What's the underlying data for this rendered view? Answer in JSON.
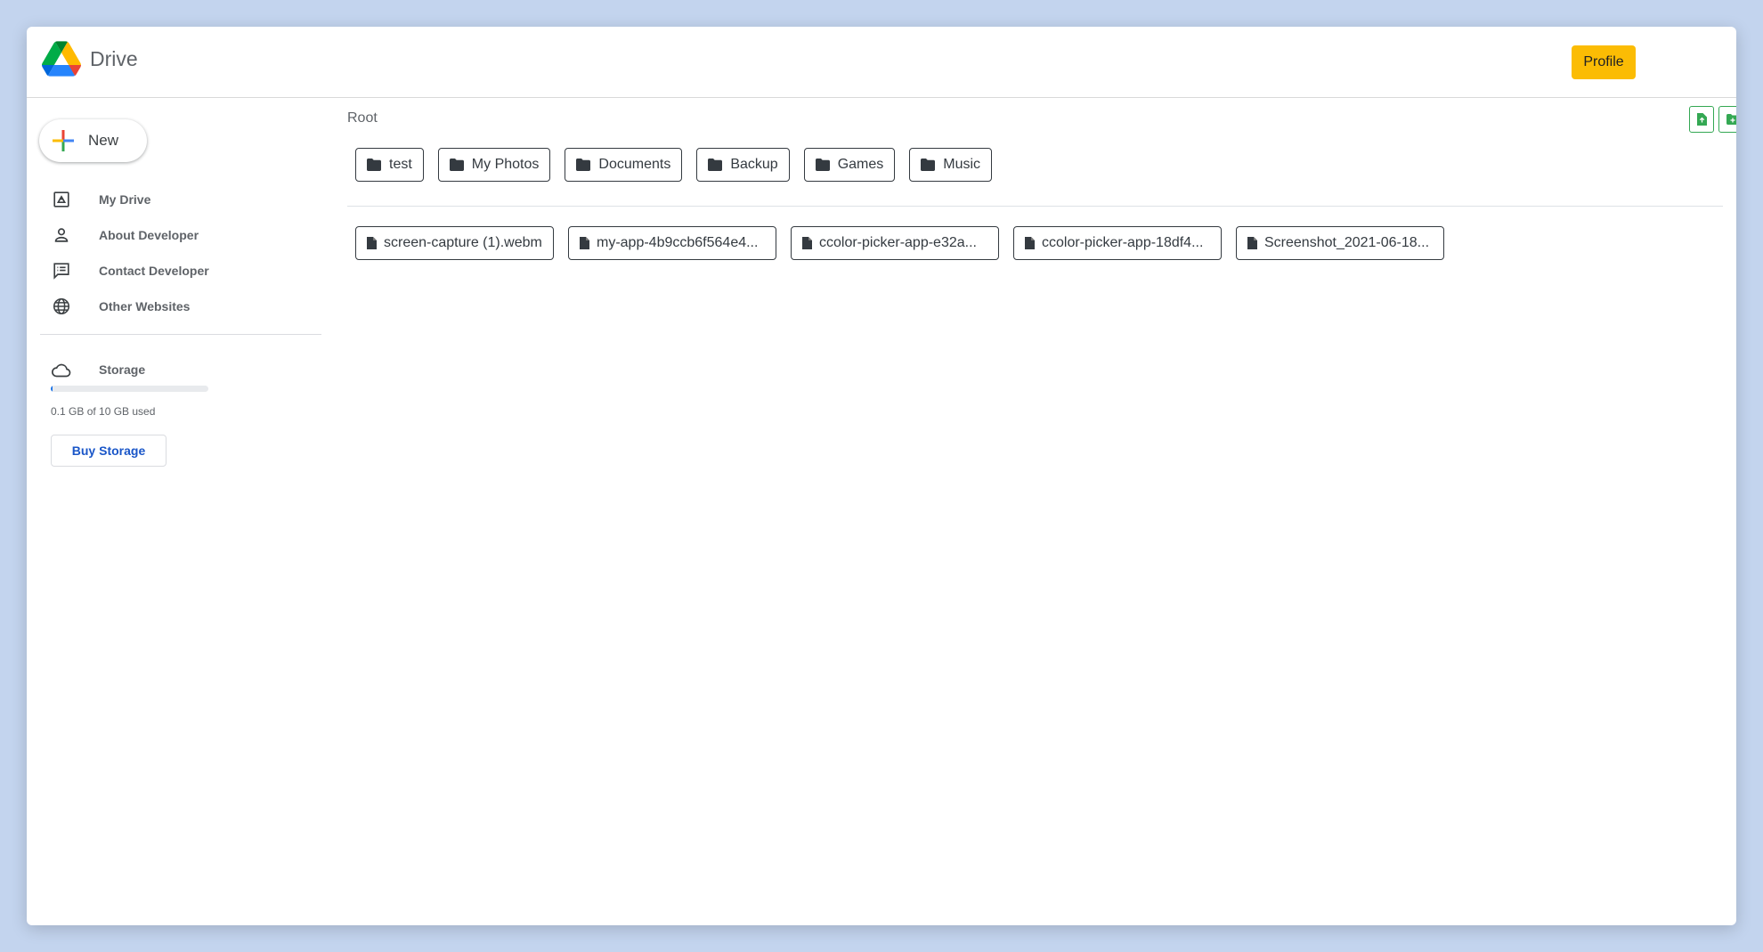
{
  "header": {
    "app_name": "Drive",
    "profile_label": "Profile"
  },
  "sidebar": {
    "new_label": "New",
    "items": [
      {
        "label": "My Drive",
        "icon": "drive-icon"
      },
      {
        "label": "About Developer",
        "icon": "person-icon"
      },
      {
        "label": "Contact Developer",
        "icon": "feedback-icon"
      },
      {
        "label": "Other Websites",
        "icon": "globe-icon"
      }
    ],
    "storage": {
      "label": "Storage",
      "icon": "cloud-icon",
      "usage_text": "0.1 GB of 10 GB used",
      "used_fraction": 0.01,
      "buy_label": "Buy Storage"
    }
  },
  "main": {
    "breadcrumb": "Root",
    "folders": [
      "test",
      "My Photos",
      "Documents",
      "Backup",
      "Games",
      "Music"
    ],
    "files": [
      "screen-capture (1).webm",
      "my-app-4b9ccb6f564e4...",
      "ccolor-picker-app-e32a...",
      "ccolor-picker-app-18df4...",
      "Screenshot_2021-06-18..."
    ]
  },
  "colors": {
    "background": "#c3d4ee",
    "profile_button": "#fbbc04",
    "action_border": "#34a853",
    "link_blue": "#1a56c8"
  }
}
